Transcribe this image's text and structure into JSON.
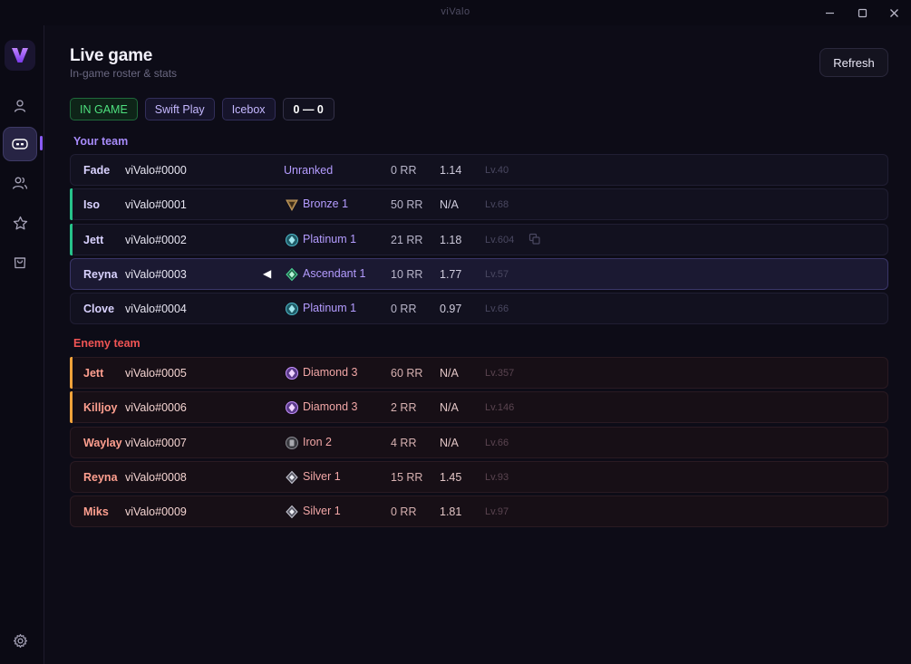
{
  "window": {
    "title": "viValo",
    "minimize_icon": "minimize-icon",
    "maximize_icon": "maximize-icon",
    "close_icon": "close-icon"
  },
  "sidebar": {
    "logo": "V",
    "items": [
      {
        "id": "profile",
        "icon": "user-icon"
      },
      {
        "id": "live-game",
        "icon": "gamepad-icon",
        "active": true
      },
      {
        "id": "friends",
        "icon": "users-icon"
      },
      {
        "id": "favorites",
        "icon": "star-icon"
      },
      {
        "id": "store",
        "icon": "bag-icon"
      }
    ],
    "settings_icon": "gear-icon"
  },
  "header": {
    "title": "Live game",
    "subtitle": "In-game roster & stats",
    "refresh_label": "Refresh"
  },
  "match": {
    "status": "IN GAME",
    "mode": "Swift Play",
    "map": "Icebox",
    "score": "0 — 0"
  },
  "colors": {
    "accent": "#8b5cf6",
    "ally_label": "#a78bfa",
    "enemy_label": "#f05454",
    "status_green": "#4ee07e",
    "party_green": "#27c28a",
    "party_orange": "#f0a23a"
  },
  "your_team": {
    "label": "Your team",
    "players": [
      {
        "agent": "Fade",
        "name": "viValo#0000",
        "rank": "Unranked",
        "rank_icon": "",
        "rr": "0 RR",
        "kd": "1.14",
        "level": "Lv.40",
        "party": "",
        "self": false
      },
      {
        "agent": "Iso",
        "name": "viValo#0001",
        "rank": "Bronze 1",
        "rank_icon": "bronze",
        "rr": "50 RR",
        "kd": "N/A",
        "level": "Lv.68",
        "party": "green",
        "self": false
      },
      {
        "agent": "Jett",
        "name": "viValo#0002",
        "rank": "Platinum 1",
        "rank_icon": "platinum",
        "rr": "21 RR",
        "kd": "1.18",
        "level": "Lv.604",
        "party": "green",
        "self": false,
        "copy_icon": "copy-icon"
      },
      {
        "agent": "Reyna",
        "name": "viValo#0003",
        "rank": "Ascendant 1",
        "rank_icon": "ascendant",
        "rr": "10 RR",
        "kd": "1.77",
        "level": "Lv.57",
        "party": "",
        "self": true,
        "self_marker": "◀"
      },
      {
        "agent": "Clove",
        "name": "viValo#0004",
        "rank": "Platinum 1",
        "rank_icon": "platinum",
        "rr": "0 RR",
        "kd": "0.97",
        "level": "Lv.66",
        "party": "",
        "self": false
      }
    ]
  },
  "enemy_team": {
    "label": "Enemy team",
    "players": [
      {
        "agent": "Jett",
        "name": "viValo#0005",
        "rank": "Diamond 3",
        "rank_icon": "diamond",
        "rr": "60 RR",
        "kd": "N/A",
        "level": "Lv.357",
        "party": "orange"
      },
      {
        "agent": "Killjoy",
        "name": "viValo#0006",
        "rank": "Diamond 3",
        "rank_icon": "diamond",
        "rr": "2 RR",
        "kd": "N/A",
        "level": "Lv.146",
        "party": "orange"
      },
      {
        "agent": "Waylay",
        "name": "viValo#0007",
        "rank": "Iron 2",
        "rank_icon": "iron",
        "rr": "4 RR",
        "kd": "N/A",
        "level": "Lv.66",
        "party": ""
      },
      {
        "agent": "Reyna",
        "name": "viValo#0008",
        "rank": "Silver 1",
        "rank_icon": "silver",
        "rr": "15 RR",
        "kd": "1.45",
        "level": "Lv.93",
        "party": ""
      },
      {
        "agent": "Miks",
        "name": "viValo#0009",
        "rank": "Silver 1",
        "rank_icon": "silver",
        "rr": "0 RR",
        "kd": "1.81",
        "level": "Lv.97",
        "party": ""
      }
    ]
  }
}
